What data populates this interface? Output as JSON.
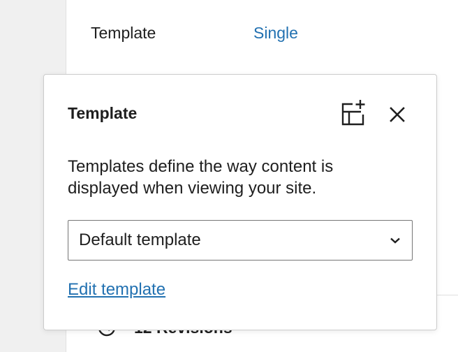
{
  "summary": {
    "label": "Template",
    "value": "Single"
  },
  "revisions": {
    "icon": "backup-icon",
    "label": "12 Revisions"
  },
  "popover": {
    "title": "Template",
    "add_icon": "add-template-icon",
    "close_icon": "close-icon",
    "description": "Templates define the way content is displayed when viewing your site.",
    "select": {
      "value": "Default template",
      "icon": "chevron-down-icon"
    },
    "edit_link": "Edit template"
  },
  "colors": {
    "link": "#2271b1",
    "text": "#1e1e1e",
    "border": "#757575",
    "background_left": "#f0f0f0"
  }
}
